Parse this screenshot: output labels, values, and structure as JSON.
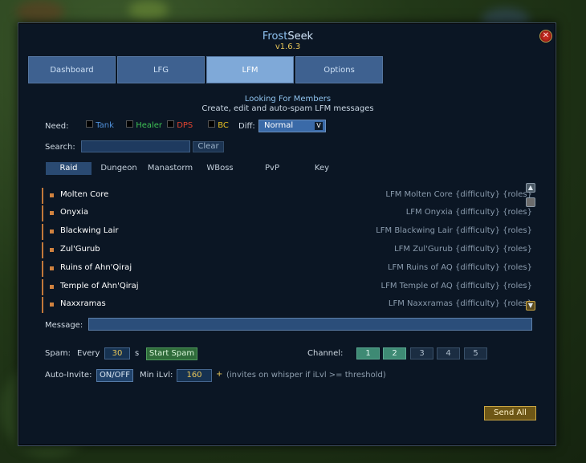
{
  "addon": {
    "name_part1": "Frost",
    "name_part2": "Seek",
    "version": "v1.6.3",
    "close_glyph": "✕"
  },
  "tabs": [
    {
      "label": "Dashboard",
      "active": false
    },
    {
      "label": "LFG",
      "active": false
    },
    {
      "label": "LFM",
      "active": true
    },
    {
      "label": "Options",
      "active": false
    }
  ],
  "header": {
    "title": "Looking For Members",
    "subtitle": "Create, edit and auto-spam LFM messages"
  },
  "need": {
    "label": "Need:",
    "roles": [
      {
        "label": "Tank",
        "color": "#4f8fd8",
        "checked": false
      },
      {
        "label": "Healer",
        "color": "#3fc255",
        "checked": false
      },
      {
        "label": "DPS",
        "color": "#e0442f",
        "checked": false
      },
      {
        "label": "BC",
        "color": "#e8c022",
        "checked": false
      }
    ],
    "diff_label": "Diff:",
    "diff_value": "Normal",
    "diff_arrow": "V"
  },
  "search": {
    "label": "Search:",
    "value": "",
    "clear_label": "Clear"
  },
  "categories": [
    {
      "label": "Raid",
      "active": true
    },
    {
      "label": "Dungeon",
      "active": false
    },
    {
      "label": "Manastorm",
      "active": false
    },
    {
      "label": "WBoss",
      "active": false
    },
    {
      "label": "PvP",
      "active": false
    },
    {
      "label": "Key",
      "active": false
    }
  ],
  "raids": [
    {
      "name": "Molten Core",
      "template": "LFM Molten Core {difficulty} {roles}"
    },
    {
      "name": "Onyxia",
      "template": "LFM Onyxia {difficulty} {roles}"
    },
    {
      "name": "Blackwing Lair",
      "template": "LFM Blackwing Lair {difficulty} {roles}"
    },
    {
      "name": "Zul'Gurub",
      "template": "LFM Zul'Gurub {difficulty} {roles}"
    },
    {
      "name": "Ruins of Ahn'Qiraj",
      "template": "LFM Ruins of AQ {difficulty} {roles}"
    },
    {
      "name": "Temple of Ahn'Qiraj",
      "template": "LFM Temple of AQ {difficulty} {roles}"
    },
    {
      "name": "Naxxramas",
      "template": "LFM Naxxramas {difficulty} {roles}"
    }
  ],
  "scroll": {
    "up_glyph": "▲",
    "down_glyph": "▼"
  },
  "message": {
    "label": "Message:",
    "value": ""
  },
  "spam": {
    "label": "Spam:",
    "every_label": "Every",
    "interval": "30",
    "unit": "s",
    "start_label": "Start Spam"
  },
  "channel": {
    "label": "Channel:",
    "buttons": [
      {
        "label": "1",
        "on": true
      },
      {
        "label": "2",
        "on": true
      },
      {
        "label": "3",
        "on": false
      },
      {
        "label": "4",
        "on": false
      },
      {
        "label": "5",
        "on": false
      }
    ]
  },
  "auto_invite": {
    "label": "Auto-Invite:",
    "toggle_label": "ON/OFF",
    "min_ilvl_label": "Min iLvl:",
    "min_ilvl_value": "160",
    "plus": "+",
    "hint": "(invites on whisper if iLvl >= threshold)"
  },
  "send_all_label": "Send All"
}
